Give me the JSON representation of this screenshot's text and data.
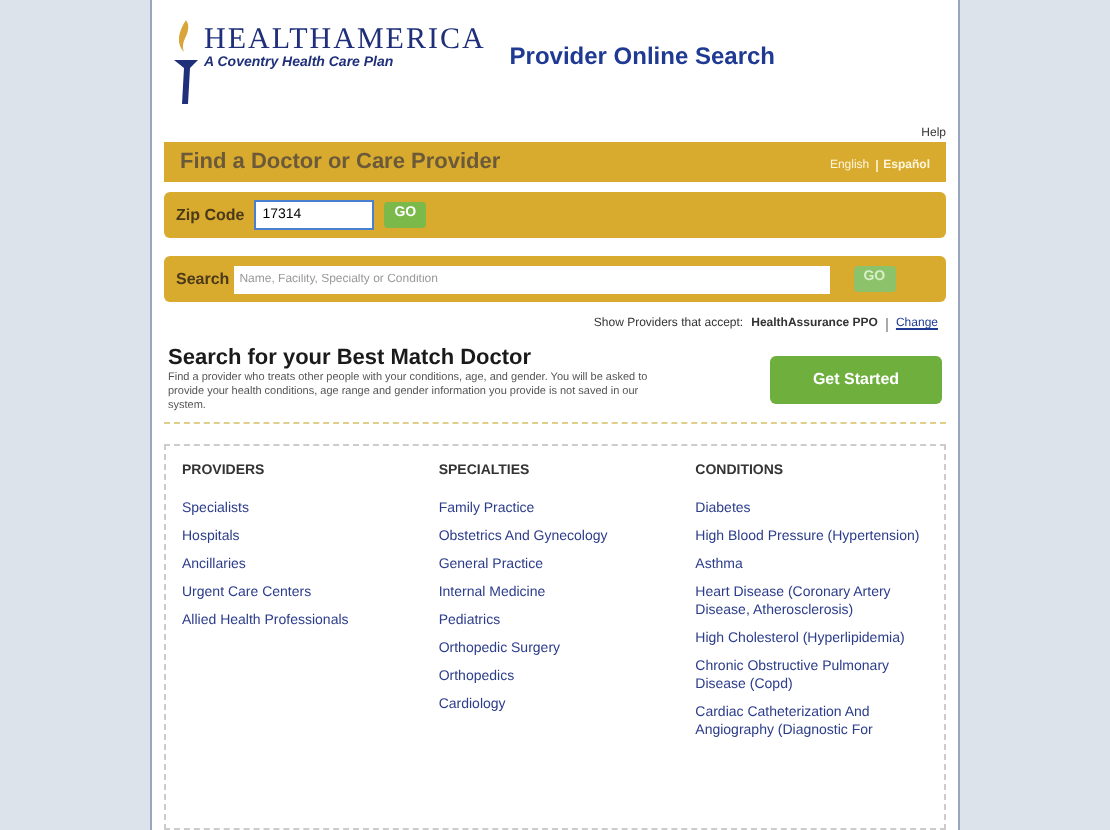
{
  "header": {
    "brand": "HEALTHAMERICA",
    "tagline": "A Coventry Health Care Plan",
    "title": "Provider Online Search",
    "help_link": "Help"
  },
  "find_bar": {
    "title": "Find a Doctor or Care Provider",
    "languages": [
      {
        "label": "English",
        "selected": false
      },
      {
        "label": "Español",
        "selected": true
      }
    ]
  },
  "zip_search": {
    "label": "Zip Code",
    "value": "17314",
    "button": "GO"
  },
  "name_search": {
    "label": "Search",
    "placeholder": "Name, Facility, Specialty or Condition",
    "button": "GO"
  },
  "plan_line": {
    "text": "Show Providers that accept:",
    "plan": "HealthAssurance PPO",
    "change_link": "Change"
  },
  "best_match": {
    "title": "Search for your Best Match Doctor",
    "description": "Find a provider who treats other people with your conditions, age, and gender. You will be asked to provide your health conditions, age range and gender information you provide is not saved in our system.",
    "button": "Get Started"
  },
  "columns": [
    {
      "heading": "PROVIDERS",
      "items": [
        "Specialists",
        "Hospitals",
        "Ancillaries",
        "Urgent Care Centers",
        "Allied Health Professionals"
      ]
    },
    {
      "heading": "SPECIALTIES",
      "items": [
        "Family Practice",
        "Obstetrics And Gynecology",
        "General Practice",
        "Internal Medicine",
        "Pediatrics",
        "Orthopedic Surgery",
        "Orthopedics",
        "Cardiology"
      ]
    },
    {
      "heading": "CONDITIONS",
      "items": [
        "Diabetes",
        "High Blood Pressure (Hypertension)",
        "Asthma",
        "Heart Disease (Coronary Artery Disease, Atherosclerosis)",
        "High Cholesterol (Hyperlipidemia)",
        "Chronic Obstructive Pulmonary Disease (Copd)",
        "Cardiac Catheterization And Angiography (Diagnostic For"
      ]
    }
  ]
}
